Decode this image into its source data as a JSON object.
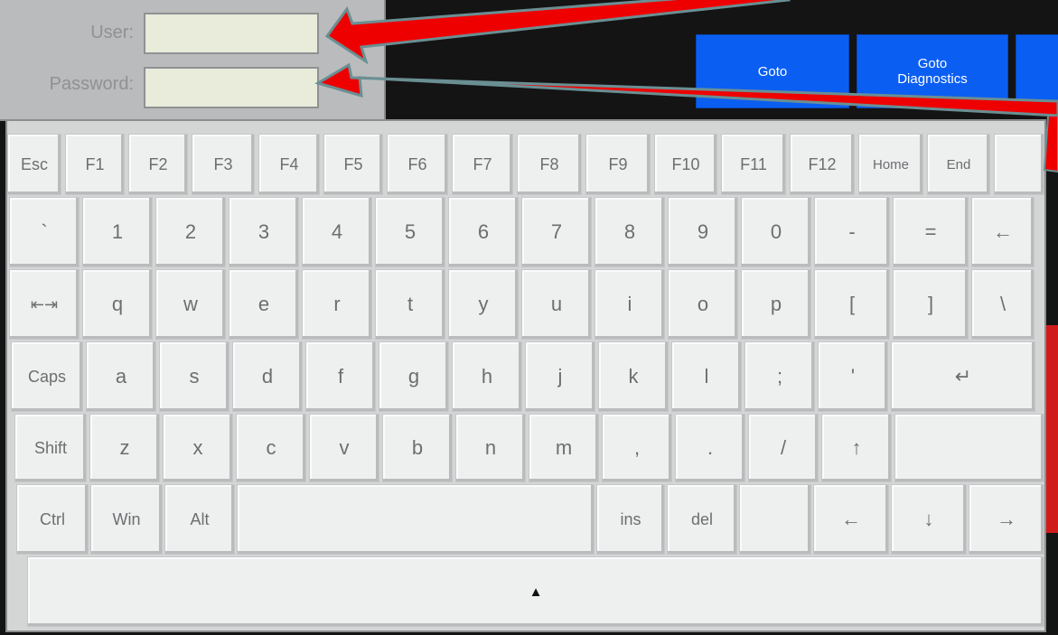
{
  "login": {
    "user_label": "User:",
    "password_label": "Password:",
    "user_value": "",
    "password_value": ""
  },
  "nav_buttons": [
    {
      "label": "Goto"
    },
    {
      "label": "Goto\nDiagnostics"
    }
  ],
  "keyboard": {
    "function_row": [
      "Esc",
      "F1",
      "F2",
      "F3",
      "F4",
      "F5",
      "F6",
      "F7",
      "F8",
      "F9",
      "F10",
      "F11",
      "F12",
      "Home",
      "End"
    ],
    "number_row": [
      "`",
      "1",
      "2",
      "3",
      "4",
      "5",
      "6",
      "7",
      "8",
      "9",
      "0",
      "-",
      "=",
      "←"
    ],
    "top_row": [
      "⇤⇥",
      "q",
      "w",
      "e",
      "r",
      "t",
      "y",
      "u",
      "i",
      "o",
      "p",
      "[",
      "]",
      "\\"
    ],
    "home_row": [
      "Caps",
      "a",
      "s",
      "d",
      "f",
      "g",
      "h",
      "j",
      "k",
      "l",
      ";",
      "'",
      "↵"
    ],
    "shift_row": [
      "Shift",
      "z",
      "x",
      "c",
      "v",
      "b",
      "n",
      "m",
      ",",
      ".",
      "/",
      "↑"
    ],
    "bottom_row": [
      "Ctrl",
      "Win",
      "Alt",
      "ins",
      "del",
      "←",
      "↓",
      "→"
    ],
    "toggle": "▲"
  },
  "colors": {
    "accent_blue": "#0b5ef2",
    "annotation_red": "#ee0000",
    "key_face": "#eeefef"
  }
}
